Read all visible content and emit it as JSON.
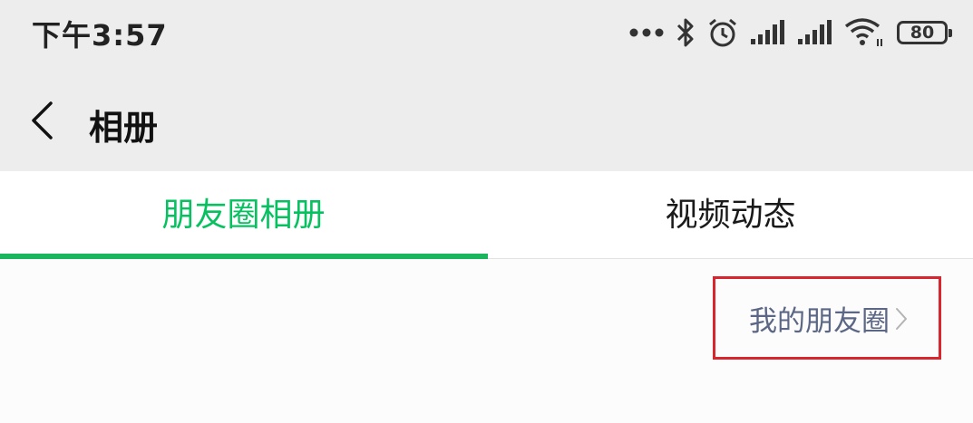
{
  "status_bar": {
    "time": "下午3:57",
    "battery_level": "80",
    "icons": [
      "more-dots-icon",
      "bluetooth-icon",
      "alarm-icon",
      "signal-icon",
      "signal-icon",
      "wifi-icon",
      "battery-icon"
    ]
  },
  "header": {
    "back_icon": "chevron-left-icon",
    "title": "相册"
  },
  "tabs": [
    {
      "label": "朋友圈相册",
      "active": true
    },
    {
      "label": "视频动态",
      "active": false
    }
  ],
  "content": {
    "moments_link_label": "我的朋友圈",
    "moments_link_icon": "chevron-right-icon"
  },
  "colors": {
    "accent": "#07c160",
    "indicator": "#1ab55c",
    "header_bg": "#ededed",
    "link_text": "#5c6785",
    "highlight_border": "#d9252e"
  }
}
